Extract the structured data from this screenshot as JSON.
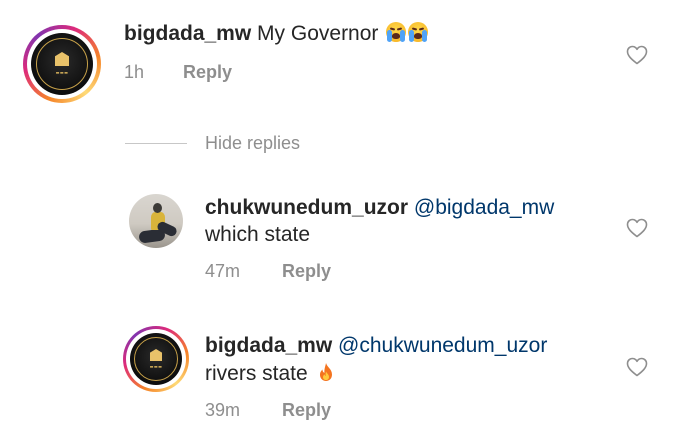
{
  "comments": [
    {
      "username": "bigdada_mw",
      "text": "My Governor",
      "emoji": "loudly-crying-face-icon",
      "time": "1h",
      "reply_label": "Reply"
    }
  ],
  "hide_replies_label": "Hide replies",
  "replies": [
    {
      "username": "chukwunedum_uzor",
      "mention": "@bigdada_mw",
      "text": "which state",
      "time": "47m",
      "reply_label": "Reply"
    },
    {
      "username": "bigdada_mw",
      "mention": "@chukwunedum_uzor",
      "text": "rivers state",
      "emoji": "fire-icon",
      "time": "39m",
      "reply_label": "Reply"
    }
  ],
  "colors": {
    "text": "#262626",
    "meta": "#8e8e8e",
    "mention": "#00376b",
    "divider": "#c7c7c7"
  }
}
